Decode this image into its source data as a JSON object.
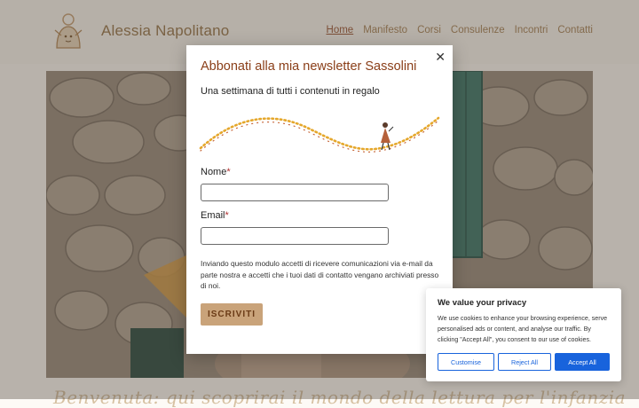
{
  "header": {
    "brand": "Alessia Napolitano",
    "nav": [
      "Home",
      "Manifesto",
      "Corsi",
      "Consulenze",
      "Incontri",
      "Contatti"
    ]
  },
  "hero": {
    "tagline": "Benvenuta: qui scoprirai il mondo della lettura per l'infanzia"
  },
  "modal": {
    "close_icon": "close-icon",
    "title": "Abbonati alla mia newsletter Sassolini",
    "subtitle": "Una settimana di tutti i contenuti in regalo",
    "name_label": "Nome",
    "email_label": "Email",
    "required_mark": "*",
    "consent": "Inviando questo modulo accetti di ricevere comunicazioni via e-mail da parte nostra e accetti che i tuoi dati di contatto vengano archiviati presso di noi.",
    "submit": "ISCRIVITI"
  },
  "cookie": {
    "title": "We value your privacy",
    "text": "We use cookies to enhance your browsing experience, serve personalised ads or content, and analyse our traffic. By clicking \"Accept All\", you consent to our use of cookies.",
    "customise": "Customise",
    "reject": "Reject All",
    "accept": "Accept All"
  },
  "colors": {
    "accent_title": "#8a3e18",
    "button_bg": "#c9a37a",
    "cookie_blue": "#1863dc"
  }
}
